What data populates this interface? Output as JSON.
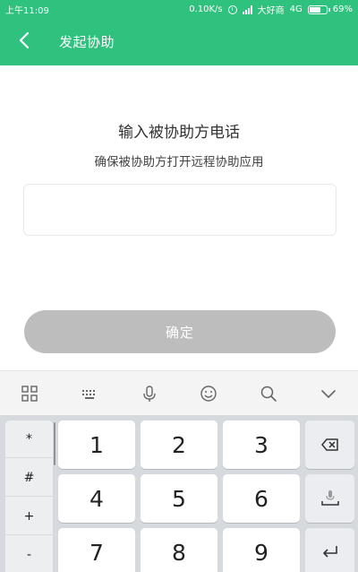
{
  "status_bar": {
    "time": "上午11:09",
    "network_speed": "0.10K/s",
    "carrier": "大好商",
    "network_type": "4G",
    "battery": "69%"
  },
  "app_bar": {
    "back_icon": "back-arrow-icon",
    "title": "发起协助"
  },
  "main": {
    "heading": "输入被协助方电话",
    "subheading": "确保被协助方打开远程协助应用",
    "phone_input": {
      "value": "",
      "placeholder": ""
    },
    "confirm_label": "确定"
  },
  "keyboard_toolbar": {
    "icons": [
      "grid-icon",
      "keyboard-icon",
      "microphone-icon",
      "emoji-icon",
      "search-icon",
      "collapse-keyboard-icon"
    ]
  },
  "keyboard": {
    "symbols": [
      "*",
      "#",
      "+",
      "-"
    ],
    "digits": [
      "1",
      "2",
      "3",
      "4",
      "5",
      "6",
      "7",
      "8",
      "9"
    ],
    "function_keys": [
      "backspace-icon",
      "voice-input-space-icon",
      "enter-icon"
    ]
  },
  "colors": {
    "primary": "#2fc17e",
    "button_disabled": "#bdbdbd",
    "keyboard_bg": "#d6d9de"
  }
}
